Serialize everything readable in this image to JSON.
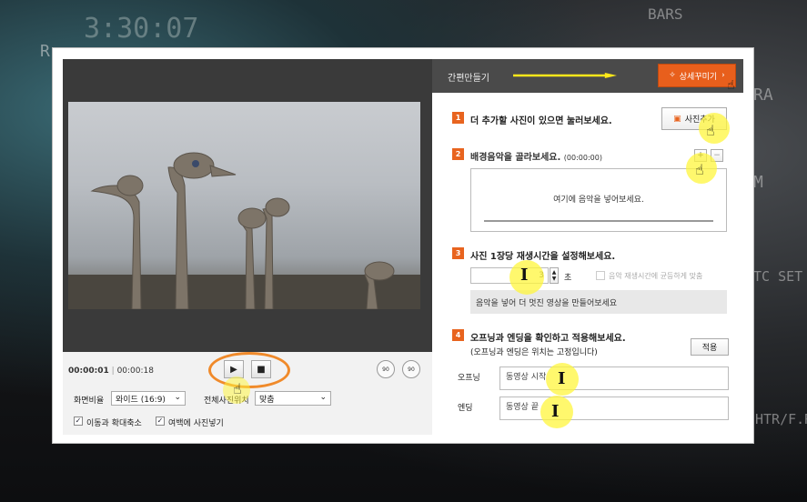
{
  "background": {
    "clock": "3:30:07",
    "bars_label": "BARS",
    "ra_label": "RA",
    "m_label": "M",
    "tcset_label": "TC SET",
    "htr_label": "HTR/F.RA",
    "r_label": "R"
  },
  "preview": {
    "time_current": "00:00:01",
    "time_total": "00:00:18",
    "play_icon": "play-icon",
    "stop_icon": "stop-icon",
    "rotate_left_label": "90",
    "rotate_right_label": "90",
    "aspect_label": "화면비율",
    "aspect_value": "와이드 (16:9)",
    "fit_label": "전체사진위치",
    "fit_value": "맞춤",
    "check_move_zoom": "이동과 확대축소",
    "check_fill_margin": "여백에 사진넣기"
  },
  "panel": {
    "title": "간편만들기",
    "detail_button": "상세꾸미기",
    "step1": {
      "num": "1",
      "text": "더 추가할 사진이 있으면 눌러보세요.",
      "button": "사진추가"
    },
    "step2": {
      "num": "2",
      "text": "배경음악을 골라보세요.",
      "duration": "(00:00:00)",
      "add": "+",
      "remove": "−",
      "placeholder": "여기에 음악을 넣어보세요."
    },
    "step3": {
      "num": "3",
      "text": "사진 1장당 재생시간을 설정해보세요.",
      "seconds_value": "3",
      "seconds_unit": "초",
      "sync_label": "음악 재생시간에 균등하게 맞춤",
      "note": "음악을 넣어 더 멋진 영상을 만들어보세요"
    },
    "step4": {
      "num": "4",
      "text": "오프닝과 엔딩을 확인하고 적용해보세요.",
      "sub": "(오프닝과 엔딩은 위치는 고정입니다)",
      "apply": "적용",
      "opening_label": "오프닝",
      "opening_value": "동영상 시작",
      "ending_label": "엔딩",
      "ending_value": "동영상 끝"
    }
  },
  "colors": {
    "accent": "#e8641f",
    "highlight": "#fff53c",
    "ring": "#f08a2a"
  }
}
